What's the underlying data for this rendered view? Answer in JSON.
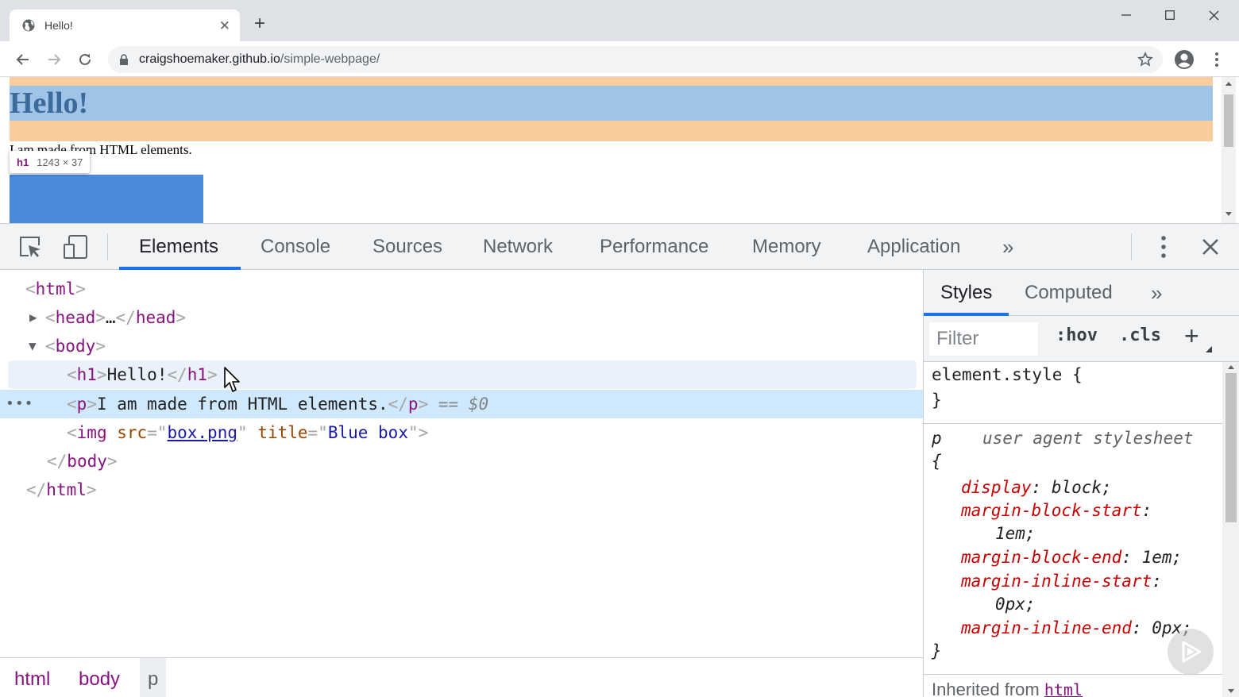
{
  "browser": {
    "tab_title": "Hello!",
    "tab_close": "✕",
    "new_tab": "+",
    "url_host": "craigshoemaker.github.io",
    "url_path": "/simple-webpage/"
  },
  "page": {
    "h1_text": "Hello!",
    "p_text": "I am made from HTML elements.",
    "inspect_tag": "h1",
    "inspect_dims": "1243 × 37"
  },
  "devtools": {
    "tabs": [
      "Elements",
      "Console",
      "Sources",
      "Network",
      "Performance",
      "Memory",
      "Application"
    ],
    "more": "»"
  },
  "dom": {
    "html_open": "html",
    "head_tag": "head",
    "head_ellipsis": "…",
    "body_tag": "body",
    "h1_tag": "h1",
    "h1_text": "Hello!",
    "p_tag": "p",
    "p_text": "I am made from HTML elements.",
    "selected_marker": "== $0",
    "img_tag": "img",
    "img_src_attr": "src",
    "img_src_val": "box.png",
    "img_title_attr": "title",
    "img_title_val": "Blue box",
    "dots": "•••"
  },
  "breadcrumbs": [
    "html",
    "body",
    "p"
  ],
  "styles": {
    "tabs": [
      "Styles",
      "Computed"
    ],
    "more": "»",
    "filter_placeholder": "Filter",
    "hov": ":hov",
    "cls": ".cls",
    "plus": "+",
    "element_style_open": "element.style {",
    "close_brace": "}",
    "open_brace": "{",
    "p_selector": "p",
    "ua_source": "user agent stylesheet",
    "props": [
      {
        "name": "display",
        "value": "block;"
      },
      {
        "name": "margin-block-start",
        "value": "1em;"
      },
      {
        "name": "margin-block-end",
        "value": "1em;"
      },
      {
        "name": "margin-inline-start",
        "value": "0px;"
      },
      {
        "name": "margin-inline-end",
        "value": "0px;"
      }
    ],
    "inherited_label": "Inherited from ",
    "inherited_link": "html"
  }
}
